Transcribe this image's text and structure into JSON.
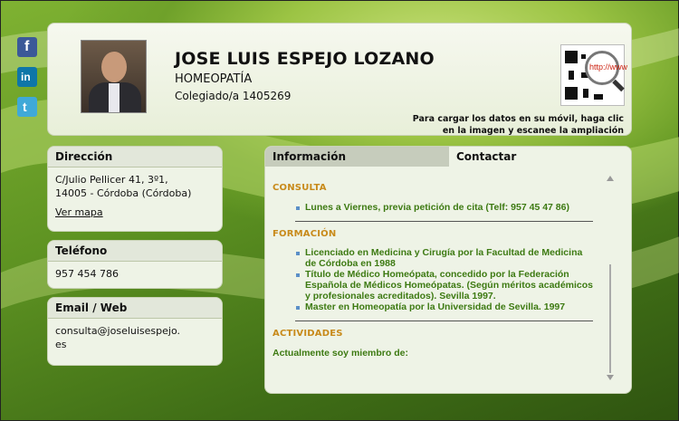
{
  "social": {
    "facebook_icon": "facebook-icon",
    "linkedin_icon": "linkedin-icon",
    "twitter_icon": "twitter-icon"
  },
  "header": {
    "name": "JOSE LUIS ESPEJO LOZANO",
    "specialty": "HOMEOPATÍA",
    "college": "Colegiado/a 1405269",
    "qr_icon": "qr-code-magnifier-icon",
    "qr_lens_text": "http://www",
    "qr_note_line1": "Para cargar los datos en su móvil, haga clic",
    "qr_note_line2": "en la imagen y escanee la ampliación"
  },
  "direccion": {
    "title": "Dirección",
    "line1": "C/Julio Pellicer 41, 3º1,",
    "line2": "14005 - Córdoba (Córdoba)",
    "map_link": "Ver mapa"
  },
  "telefono": {
    "title": "Teléfono",
    "value": "957 454 786"
  },
  "email": {
    "title": "Email / Web",
    "line1": "consulta@joseluisespejo.",
    "line2": "es"
  },
  "info": {
    "tab_info": "Información",
    "tab_contact": "Contactar",
    "consulta_title": "CONSULTA",
    "consulta_items": [
      "Lunes a Viernes, previa petición de cita (Telf: 957 45 47 86)"
    ],
    "formacion_title": "FORMACIÓN",
    "formacion_items": [
      "Licenciado en Medicina y Cirugía por la Facultad de Medicina de Córdoba en 1988",
      "Título de Médico Homeópata, concedido por la Federación Española de Médicos Homeópatas. (Según méritos académicos y profesionales acreditados). Sevilla 1997.",
      "Master en Homeopatía por la Universidad de Sevilla. 1997"
    ],
    "actividades_title": "ACTIVIDADES",
    "actividades_intro": "Actualmente soy miembro de:"
  },
  "colors": {
    "accent_orange": "#c88a1a",
    "text_green": "#3d7a12",
    "bg_green": "#4a7a1c"
  }
}
